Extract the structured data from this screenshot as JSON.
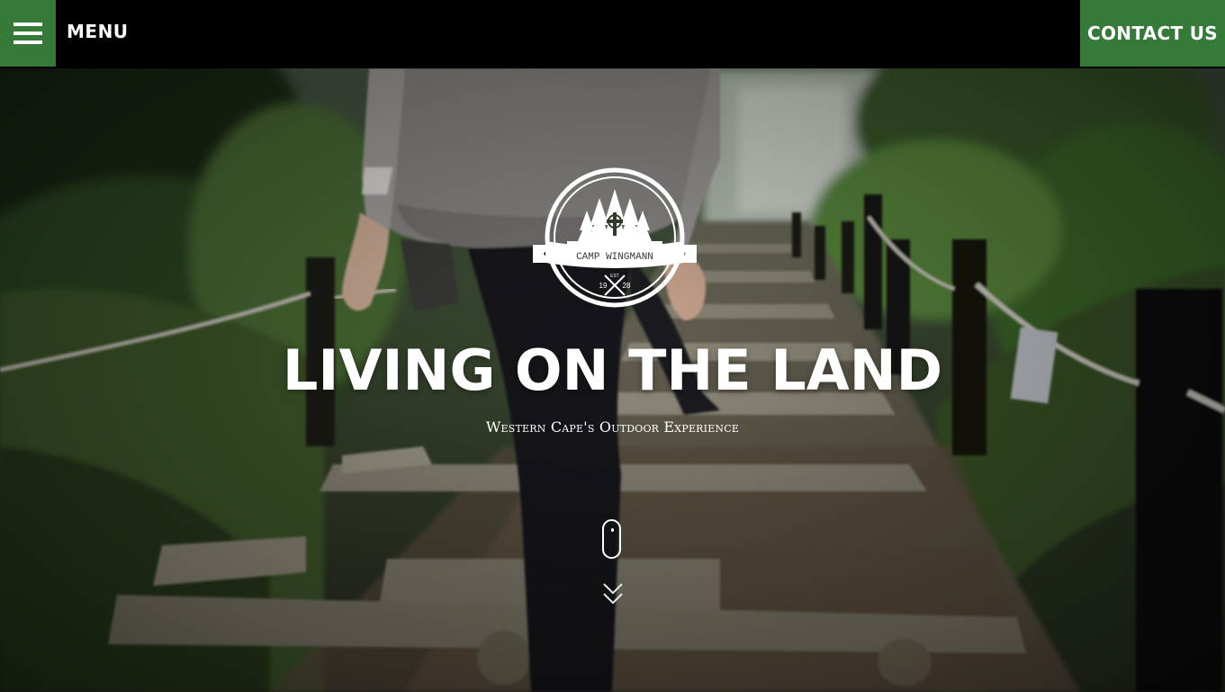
{
  "header": {
    "menu_label": "MENU",
    "contact_label": "CONTACT US",
    "accent_color": "#367a3a",
    "background_color": "#000000"
  },
  "hero": {
    "badge": {
      "name": "CAMP WINGMANN",
      "est_label": "EST",
      "year_left": "19",
      "year_right": "28"
    },
    "title": "LIVING ON THE LAND",
    "subtitle": "Western Cape's Outdoor Experience"
  },
  "icons": {
    "menu": "hamburger-icon",
    "scroll": "mouse-scroll-icon",
    "down": "double-chevron-down-icon"
  }
}
